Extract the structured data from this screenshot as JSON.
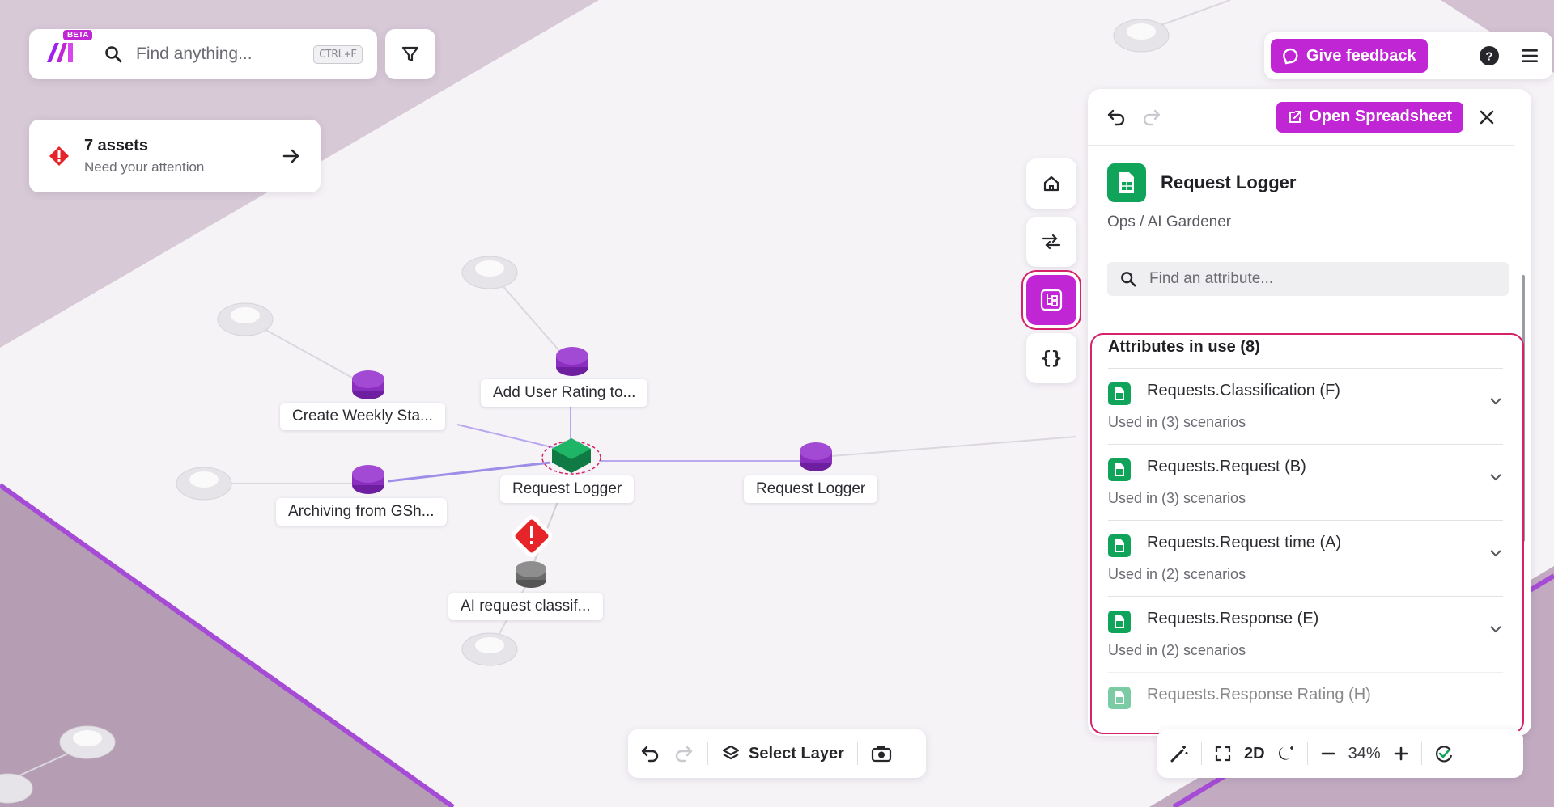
{
  "logo": {
    "badge": "BETA"
  },
  "search": {
    "placeholder": "Find anything...",
    "shortcut": "CTRL+F"
  },
  "assets_alert": {
    "title": "7 assets",
    "subtitle": "Need your attention"
  },
  "top_right": {
    "feedback_label": "Give feedback"
  },
  "graph": {
    "nodes": [
      {
        "label": "Add User Rating to..."
      },
      {
        "label": "Create Weekly Sta..."
      },
      {
        "label": "Request Logger"
      },
      {
        "label": "Request Logger"
      },
      {
        "label": "Archiving from GSh..."
      },
      {
        "label": "AI request classif..."
      }
    ]
  },
  "panel": {
    "open_label": "Open Spreadsheet",
    "title": "Request Logger",
    "breadcrumb": "Ops / AI Gardener",
    "attr_search_placeholder": "Find an attribute...",
    "attrs_heading": "Attributes in use (8)",
    "attributes": [
      {
        "name": "Requests.Classification (F)",
        "usage": "Used in (3) scenarios"
      },
      {
        "name": "Requests.Request (B)",
        "usage": "Used in (3) scenarios"
      },
      {
        "name": "Requests.Request time (A)",
        "usage": "Used in (2) scenarios"
      },
      {
        "name": "Requests.Response (E)",
        "usage": "Used in (2) scenarios"
      },
      {
        "name": "Requests.Response Rating (H)",
        "usage": ""
      }
    ]
  },
  "bottom_toolbar": {
    "select_layer": "Select Layer"
  },
  "view_toolbar": {
    "mode": "2D",
    "zoom": "34%"
  },
  "colors": {
    "accent": "#c026d3",
    "highlight": "#d5226b",
    "sheet_green": "#10a35a",
    "alert_red": "#e5252a"
  },
  "icons": [
    "search-icon",
    "filter-icon",
    "alert-icon",
    "arrow-right-icon",
    "feedback-icon",
    "help-icon",
    "menu-icon",
    "home-icon",
    "sliders-icon",
    "structure-icon",
    "braces-icon",
    "undo-icon",
    "redo-icon",
    "external-link-icon",
    "close-icon",
    "spreadsheet-icon",
    "chevron-down-icon",
    "layers-icon",
    "camera-icon",
    "magic-wand-icon",
    "fullscreen-icon",
    "moon-icon",
    "zoom-out-icon",
    "zoom-in-icon",
    "sync-check-icon"
  ]
}
